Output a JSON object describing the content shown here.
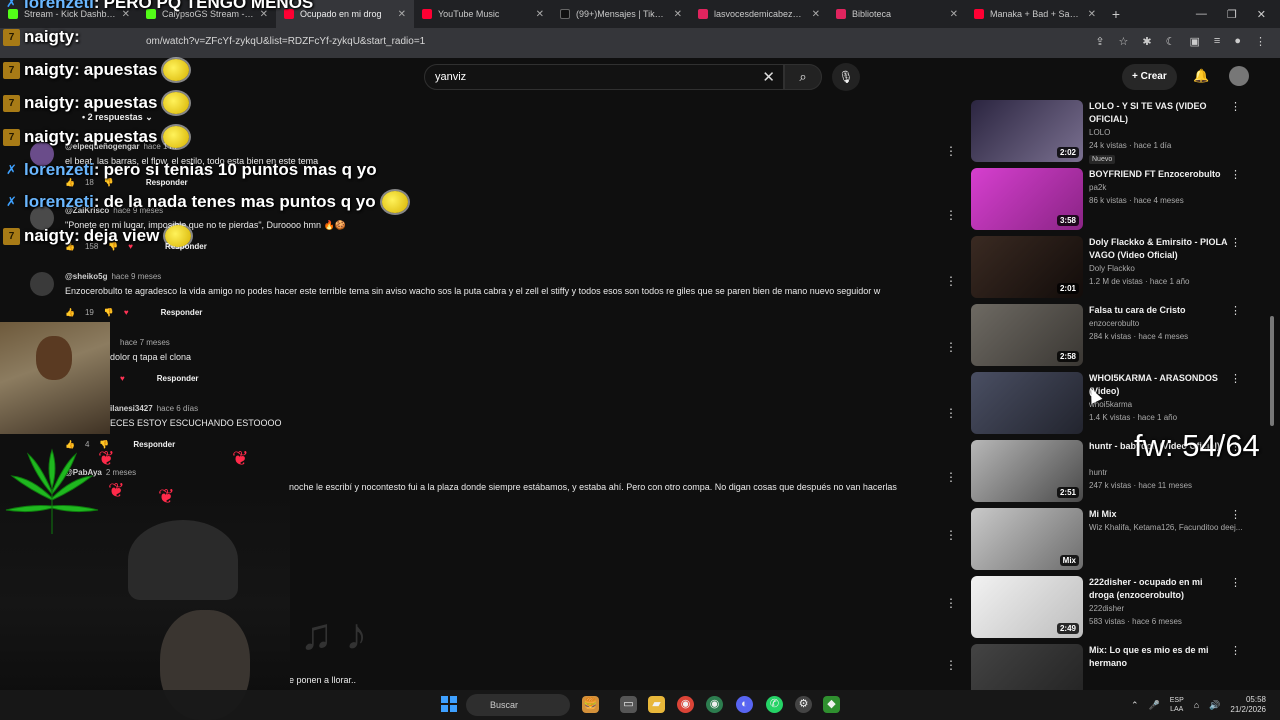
{
  "browser": {
    "tabs": [
      {
        "label": "Stream - Kick Dashboard",
        "color": "#53fc18"
      },
      {
        "label": "CalypsoGS Stream - Watc",
        "color": "#53fc18"
      },
      {
        "label": "Ocupado en mi drog",
        "color": "#ff0033"
      },
      {
        "label": "YouTube Music",
        "color": "#ff0033"
      },
      {
        "label": "(99+)Mensajes | TikTok",
        "color": "#111111"
      },
      {
        "label": "lasvocesdemicabeza por",
        "color": "#e0245e"
      },
      {
        "label": "Biblioteca",
        "color": "#e0245e"
      },
      {
        "label": "Manaka + Bad + Sad Boi",
        "color": "#ff0033"
      }
    ],
    "new_tab": "+",
    "url": "om/watch?v=ZFcYf-zykqU&list=RDZFcYf-zykqU&start_radio=1"
  },
  "youtube": {
    "search_value": "yanviz",
    "create_label": "Crear"
  },
  "chat": [
    {
      "user": "lorenzeti",
      "msg": "PERO PQ TENGO MENOS",
      "color": "#6ab7ff",
      "badge": "sword"
    },
    {
      "user": "naigty",
      "msg": "",
      "color": "#ffffff",
      "badge": "7k"
    },
    {
      "user": "naigty",
      "msg": "apuestas",
      "color": "#ffffff",
      "badge": "7k"
    },
    {
      "user": "naigty",
      "msg": "apuestas",
      "color": "#ffffff",
      "badge": "7k"
    },
    {
      "user": "naigty",
      "msg": "apuestas",
      "color": "#ffffff",
      "badge": "7k"
    },
    {
      "user": "lorenzeti",
      "msg": "pero si tenias 10 puntos mas q yo",
      "color": "#6ab7ff",
      "badge": "sword"
    },
    {
      "user": "lorenzeti",
      "msg": "de la nada tenes mas puntos q yo",
      "color": "#6ab7ff",
      "badge": "sword"
    },
    {
      "user": "naigty",
      "msg": "deja view",
      "color": "#ffffff",
      "badge": "7k"
    }
  ],
  "comments": [
    {
      "author": "@elpequeñogengar",
      "time": "hace 1 m",
      "text": "el beat, las barras, el flow, el estilo, todo esta bien en este tema",
      "likes": "18",
      "reply": "Responder"
    },
    {
      "author": "@ZaiKrisco",
      "time": "hace 9 meses",
      "text": "\"Ponete en mi lugar, imposible que no te pierdas\", Duroooo hmn 🔥🍪",
      "likes": "158",
      "reply": "Responder"
    },
    {
      "author": "@sheiko5g",
      "time": "hace 9 meses",
      "text": "Enzocerobulto te agradesco la vida amigo no podes hacer este terrible tema sin aviso wacho sos la puta cabra y el zell el stiffy y todos esos son todos re giles que se paren bien de mano nuevo seguidor w",
      "likes": "19",
      "reply": "Responder"
    },
    {
      "author": "",
      "time": "hace 7 meses",
      "text": "dolor q tapa el clona",
      "likes": "",
      "reply": "Responder"
    },
    {
      "author": "ilanesi3427",
      "time": "hace 6 días",
      "text": "ECES ESTOY ESCUCHANDO ESTOOOO",
      "likes": "4",
      "reply": "Responder"
    },
    {
      "author": "@PabAya",
      "time": "2 meses",
      "text": "noche le escribí y nocontesto fui a la plaza donde siempre estábamos, y estaba ahí. Pero con otro compa. No digan cosas que después no van hacerlas",
      "likes": "",
      "reply": ""
    },
    {
      "author": "",
      "time": "",
      "text": "e ponen a llorar..",
      "likes": "",
      "reply": ""
    }
  ],
  "replies_toggle": "2 respuestas",
  "sidebar": [
    {
      "title": "LOLO - Y SI TE VAS (VIDEO OFICIAL)",
      "channel": "LOLO",
      "meta": "24 k vistas · hace 1 día",
      "duration": "2:02",
      "badge": "Nuevo",
      "thumb": [
        "#2b2540",
        "#7a7090"
      ]
    },
    {
      "title": "BOYFRIEND FT Enzocerobulto",
      "channel": "pa2k",
      "meta": "86 k vistas · hace 4 meses",
      "duration": "3:58",
      "badge": "",
      "thumb": [
        "#d63fcf",
        "#8a2485"
      ]
    },
    {
      "title": "Doly Flackko & Emirsito - PIOLA VAGO (Video Oficial)",
      "channel": "Doly Flackko",
      "meta": "1.2 M de vistas · hace 1 año",
      "duration": "2:01",
      "badge": "",
      "thumb": [
        "#3a2a22",
        "#120c0a"
      ]
    },
    {
      "title": "Falsa tu cara de Cristo",
      "channel": "enzocerobulto",
      "meta": "284 k vistas · hace 4 meses",
      "duration": "2:58",
      "badge": "",
      "thumb": [
        "#6e6a63",
        "#3a3733"
      ]
    },
    {
      "title": "WHOI5KARMA - ARASONDOS (Video)",
      "channel": "whoi5karma",
      "meta": "1.4 K vistas · hace 1 año",
      "duration": "",
      "badge": "",
      "thumb": [
        "#4a4f63",
        "#22242e"
      ]
    },
    {
      "title": "huntr - babydoll (Video Oficial)",
      "channel": "huntr",
      "meta": "247 k vistas · hace 11 meses",
      "duration": "2:51",
      "badge": "",
      "thumb": [
        "#b7b7b7",
        "#4a4a4a"
      ]
    },
    {
      "title": "Mi Mix",
      "channel": "Wiz Khalifa, Ketama126, Facunditoo deej...",
      "meta": "",
      "duration": "Mix",
      "badge": "",
      "thumb": [
        "#c9c9c9",
        "#6d6d6d"
      ]
    },
    {
      "title": "222disher - ocupado en mi droga (enzocerobulto)",
      "channel": "222disher",
      "meta": "583 vistas · hace 6 meses",
      "duration": "2:49",
      "badge": "",
      "thumb": [
        "#f2f2f2",
        "#bdbdbd"
      ]
    },
    {
      "title": "Mix: Lo que es mio es de mi hermano",
      "channel": "",
      "meta": "",
      "duration": "",
      "badge": "",
      "thumb": [
        "#444444",
        "#222222"
      ]
    }
  ],
  "overlay": {
    "fw": "fw: 54/64"
  },
  "taskbar": {
    "search_label": "Buscar",
    "lang_top": "ESP",
    "lang_bottom": "LAA",
    "time": "05:58",
    "date": "21/2/2026"
  }
}
